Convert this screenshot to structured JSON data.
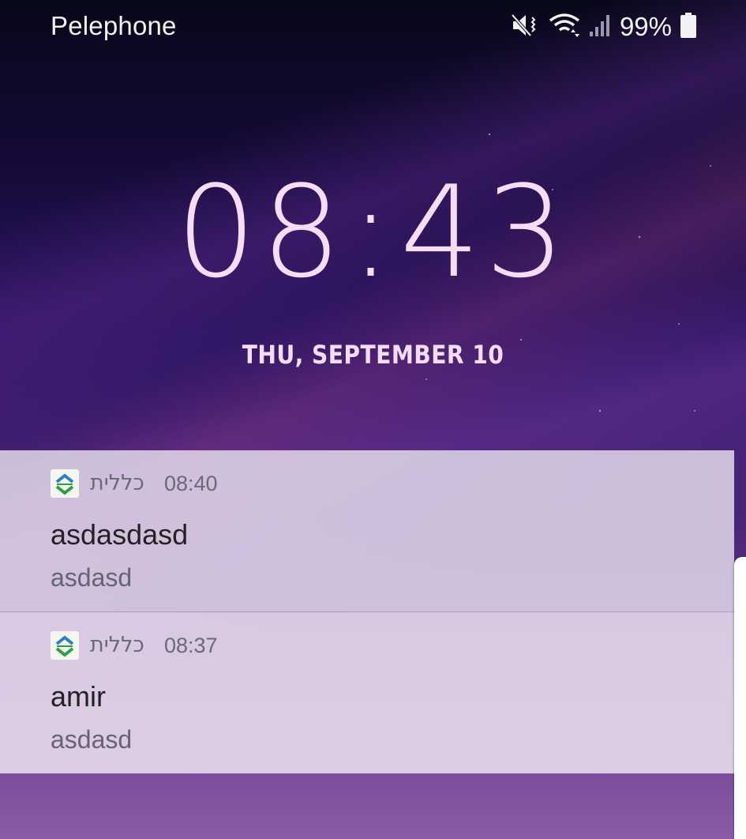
{
  "status_bar": {
    "carrier": "Pelephone",
    "battery_percent": "99%",
    "icons": [
      "mute-icon",
      "wifi-icon",
      "signal-icon",
      "battery-icon"
    ]
  },
  "lockscreen": {
    "clock": {
      "hours": "08",
      "separator": ":",
      "minutes": "43"
    },
    "date": "THU, SEPTEMBER 10"
  },
  "notifications": [
    {
      "app_name": "כללית",
      "time": "08:40",
      "title": "asdasdasd",
      "body": "asdasd"
    },
    {
      "app_name": "כללית",
      "time": "08:37",
      "title": "amir",
      "body": "asdasd"
    }
  ],
  "colors": {
    "clock": "#f6dcf6",
    "notification_bg": "#e8e0ee",
    "app_icon_green": "#2e9e45",
    "app_icon_blue": "#2d7fc1"
  }
}
